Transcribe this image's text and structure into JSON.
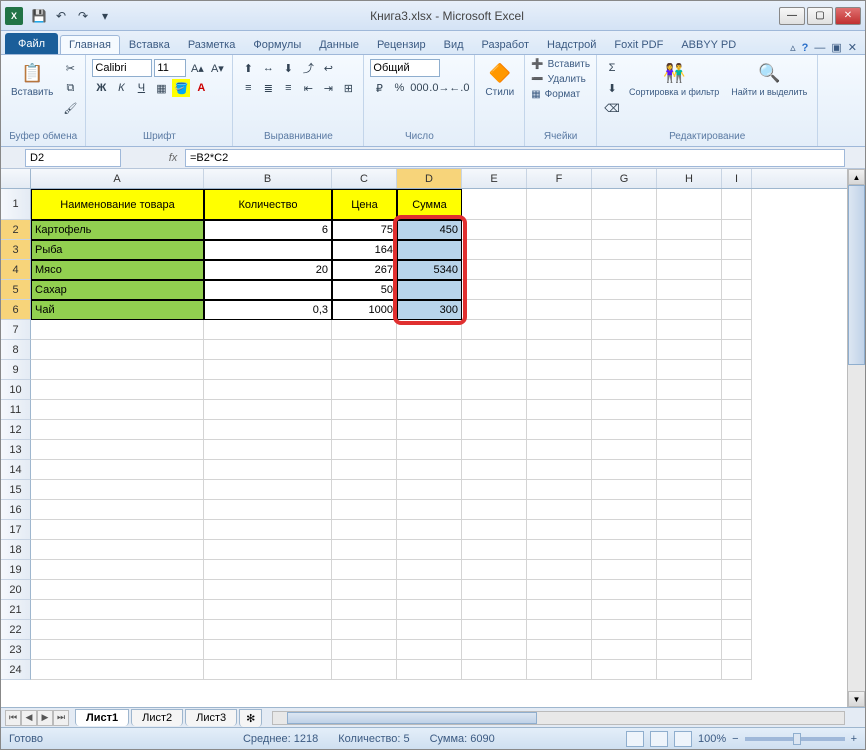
{
  "title": "Книга3.xlsx - Microsoft Excel",
  "qat": {
    "save": "💾",
    "undo": "↶",
    "redo": "↷"
  },
  "tabs": {
    "file": "Файл",
    "list": [
      "Главная",
      "Вставка",
      "Разметка",
      "Формулы",
      "Данные",
      "Рецензир",
      "Вид",
      "Разработ",
      "Надстрой",
      "Foxit PDF",
      "ABBYY PD"
    ],
    "active": 0
  },
  "ribbon": {
    "clipboard": {
      "paste": "Вставить",
      "label": "Буфер обмена"
    },
    "font": {
      "name": "Calibri",
      "size": "11",
      "label": "Шрифт"
    },
    "align": {
      "label": "Выравнивание"
    },
    "number": {
      "format": "Общий",
      "label": "Число"
    },
    "styles": {
      "btn": "Стили",
      "label": ""
    },
    "cells": {
      "insert": "Вставить",
      "delete": "Удалить",
      "format": "Формат",
      "label": "Ячейки"
    },
    "editing": {
      "sort": "Сортировка и фильтр",
      "find": "Найти и выделить",
      "label": "Редактирование"
    }
  },
  "namebox": "D2",
  "fx": "fx",
  "formula": "=B2*C2",
  "columns": [
    "A",
    "B",
    "C",
    "D",
    "E",
    "F",
    "G",
    "H",
    "I"
  ],
  "headers": {
    "name": "Наименование товара",
    "qty": "Количество",
    "price": "Цена",
    "sum": "Сумма"
  },
  "rows": [
    {
      "name": "Картофель",
      "qty": "6",
      "price": "75",
      "sum": "450"
    },
    {
      "name": "Рыба",
      "qty": "",
      "price": "164",
      "sum": ""
    },
    {
      "name": "Мясо",
      "qty": "20",
      "price": "267",
      "sum": "5340"
    },
    {
      "name": "Сахар",
      "qty": "",
      "price": "50",
      "sum": ""
    },
    {
      "name": "Чай",
      "qty": "0,3",
      "price": "1000",
      "sum": "300"
    }
  ],
  "chart_data": {
    "type": "table",
    "columns": [
      "Наименование товара",
      "Количество",
      "Цена",
      "Сумма"
    ],
    "data": [
      [
        "Картофель",
        6,
        75,
        450
      ],
      [
        "Рыба",
        null,
        164,
        null
      ],
      [
        "Мясо",
        20,
        267,
        5340
      ],
      [
        "Сахар",
        null,
        50,
        null
      ],
      [
        "Чай",
        0.3,
        1000,
        300
      ]
    ]
  },
  "sheets": [
    "Лист1",
    "Лист2",
    "Лист3"
  ],
  "status": {
    "ready": "Готово",
    "avg_label": "Среднее:",
    "avg": "1218",
    "count_label": "Количество:",
    "count": "5",
    "sum_label": "Сумма:",
    "sum": "6090",
    "zoom": "100%"
  }
}
